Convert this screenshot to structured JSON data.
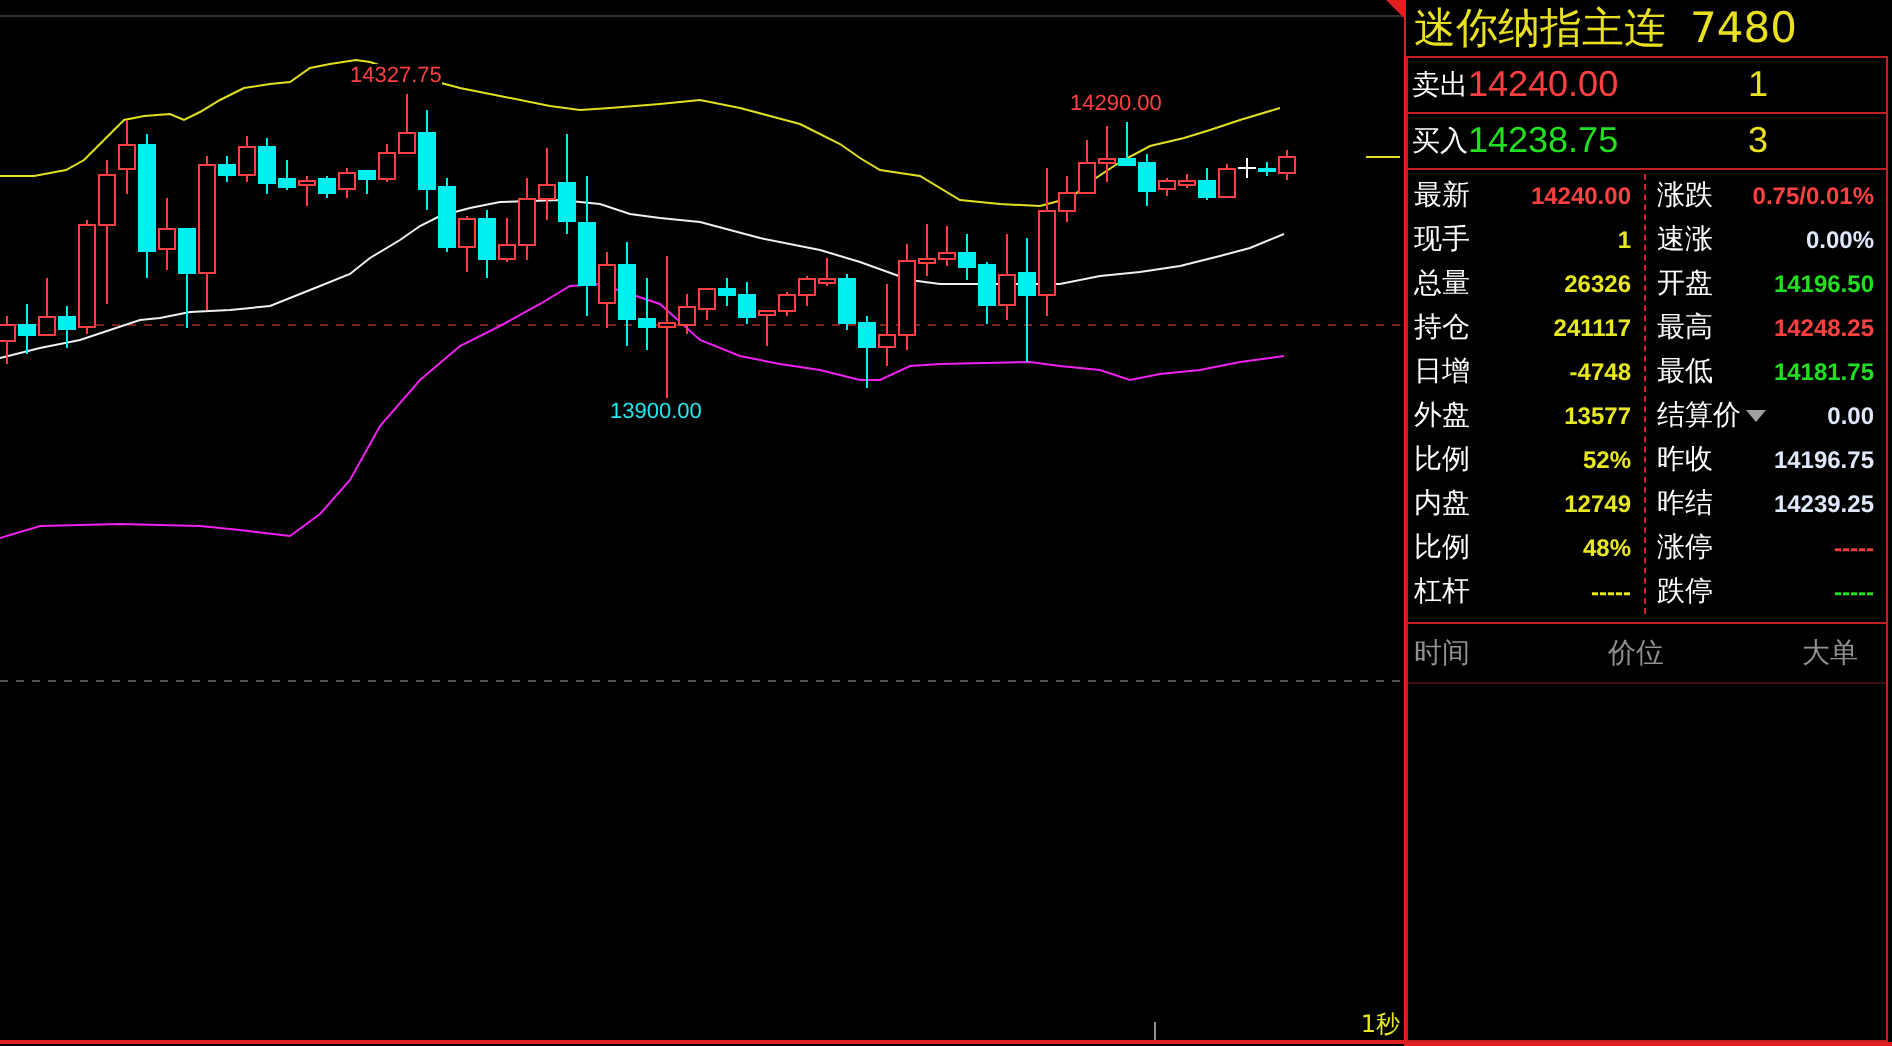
{
  "chart": {
    "labels": [
      {
        "text": "14327.75",
        "kind": "high"
      },
      {
        "text": "13900.00",
        "kind": "low"
      },
      {
        "text": "14290.00",
        "kind": "high"
      }
    ],
    "refresh": "1秒"
  },
  "title": {
    "name": "迷你纳指主连",
    "code": "7480"
  },
  "quotes": [
    {
      "label": "卖出",
      "price": "14240.00",
      "volume": "1",
      "kind": "ask"
    },
    {
      "label": "买入",
      "price": "14238.75",
      "volume": "3",
      "kind": "bid"
    }
  ],
  "left_column": [
    {
      "label": "最新",
      "value": "14240.00",
      "color": "#ff4040"
    },
    {
      "label": "现手",
      "value": "1",
      "color": "#e8e820"
    },
    {
      "label": "总量",
      "value": "26326",
      "color": "#e8e820"
    },
    {
      "label": "持仓",
      "value": "241117",
      "color": "#e8e820"
    },
    {
      "label": "日增",
      "value": "-4748",
      "color": "#e8e820"
    },
    {
      "label": "外盘",
      "value": "13577",
      "color": "#e8e820"
    },
    {
      "label": "比例",
      "value": "52%",
      "color": "#e8e820"
    },
    {
      "label": "内盘",
      "value": "12749",
      "color": "#e8e820"
    },
    {
      "label": "比例",
      "value": "48%",
      "color": "#e8e820"
    },
    {
      "label": "杠杆",
      "value": "-----",
      "color": "#e8e820"
    }
  ],
  "right_column": [
    {
      "label": "涨跌",
      "value": "0.75/0.01%",
      "color": "#ff4040"
    },
    {
      "label": "速涨",
      "value": "0.00%",
      "color": "#e0e8ff"
    },
    {
      "label": "开盘",
      "value": "14196.50",
      "color": "#20e020"
    },
    {
      "label": "最高",
      "value": "14248.25",
      "color": "#ff4040"
    },
    {
      "label": "最低",
      "value": "14181.75",
      "color": "#20e020"
    },
    {
      "label": "结算价",
      "value": "0.00",
      "color": "#e0e8ff",
      "dropdown": true
    },
    {
      "label": "昨收",
      "value": "14196.75",
      "color": "#e0e8ff"
    },
    {
      "label": "昨结",
      "value": "14239.25",
      "color": "#e0e8ff"
    },
    {
      "label": "涨停",
      "value": "-----",
      "color": "#ff4040"
    },
    {
      "label": "跌停",
      "value": "-----",
      "color": "#20e020"
    }
  ],
  "ticks_header": [
    "时间",
    "价位",
    "大单"
  ]
}
